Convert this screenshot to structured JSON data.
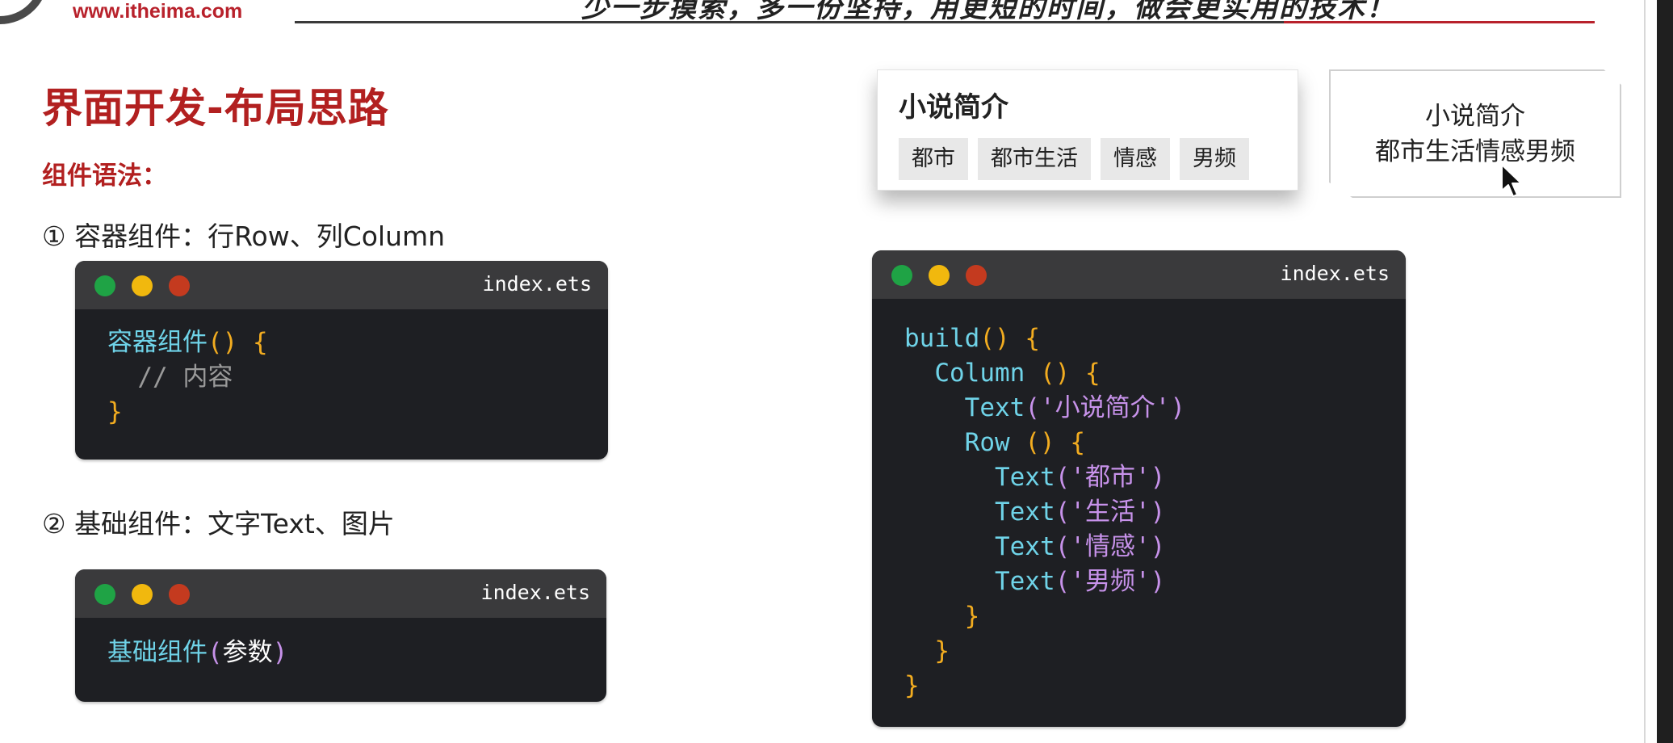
{
  "header": {
    "site_url": "www.itheima.com",
    "slogan": "少一步摸索，多一份坚持，用更短的时间，做会更实用的技术！"
  },
  "slide": {
    "title": "界面开发-布局思路",
    "section_label": "组件语法：",
    "item1": "① 容器组件：行Row、列Column",
    "item2": "② 基础组件：文字Text、图片"
  },
  "code_window_1": {
    "filename": "index.ets",
    "lines": {
      "l1_kw": "容器组件",
      "l1_paren": "()",
      "l1_brace": " {",
      "l2_comment": "  // 内容",
      "l3_brace": "}"
    }
  },
  "code_window_2": {
    "filename": "index.ets",
    "lines": {
      "l1_kw": "基础组件",
      "l1_open": "(",
      "l1_param": "参数",
      "l1_close": ")"
    }
  },
  "code_window_3": {
    "filename": "index.ets",
    "lines": {
      "l1_kw": "build",
      "l1_paren": "()",
      "l1_brace": " {",
      "l2_indent": "  ",
      "l2_kw": "Column",
      "l2_paren": " ()",
      "l2_brace": " {",
      "l3_indent": "    ",
      "l3_kw": "Text",
      "l3_open": "(",
      "l3_str": "'小说简介'",
      "l3_close": ")",
      "l4_indent": "    ",
      "l4_kw": "Row",
      "l4_paren": " ()",
      "l4_brace": " {",
      "l5_indent": "      ",
      "l5_kw": "Text",
      "l5_open": "(",
      "l5_str": "'都市'",
      "l5_close": ")",
      "l6_indent": "      ",
      "l6_kw": "Text",
      "l6_open": "(",
      "l6_str": "'生活'",
      "l6_close": ")",
      "l7_indent": "      ",
      "l7_kw": "Text",
      "l7_open": "(",
      "l7_str": "'情感'",
      "l7_close": ")",
      "l8_indent": "      ",
      "l8_kw": "Text",
      "l8_open": "(",
      "l8_str": "'男频'",
      "l8_close": ")",
      "l9_indent": "    ",
      "l9_brace": "}",
      "l10_indent": "  ",
      "l10_brace": "}",
      "l11_brace": "}"
    }
  },
  "preview_card": {
    "title": "小说简介",
    "tags": [
      "都市",
      "都市生活",
      "情感",
      "男频"
    ]
  },
  "note_card": {
    "line1": "小说简介",
    "line2": "都市生活情感男频"
  },
  "colors": {
    "brand_red": "#b22020",
    "code_bg": "#1e1f23",
    "keyword": "#6fd3e8",
    "brace": "#f2ac20",
    "string": "#c792ea"
  },
  "icons": {
    "traffic_lights": [
      "green-dot-icon",
      "yellow-dot-icon",
      "red-dot-icon"
    ],
    "cursor": "mouse-pointer-icon"
  }
}
